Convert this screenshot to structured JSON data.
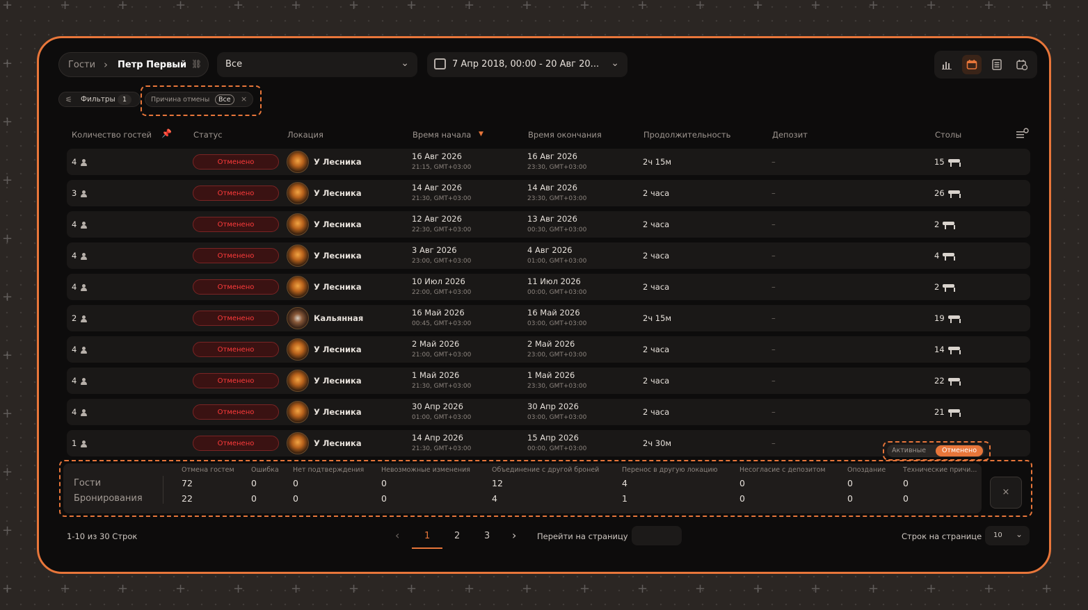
{
  "breadcrumb": {
    "root": "Гости",
    "separator": "›",
    "current": "Петр Первый"
  },
  "filter_select": {
    "value": "Все"
  },
  "date_range": {
    "value": "7 Апр 2018, 00:00 - 20 Авг 20..."
  },
  "view_icons": [
    "chart-icon",
    "calendar-icon",
    "list-icon",
    "calendar-clock-icon"
  ],
  "filters": {
    "label": "Фильтры",
    "count": "1",
    "chip_label": "Причина отмены",
    "chip_value": "Все",
    "chip_close": "×"
  },
  "columns": {
    "guests": "Количество гостей",
    "status": "Статус",
    "location": "Локация",
    "start": "Время начала",
    "end": "Время окончания",
    "duration": "Продолжительность",
    "deposit": "Депозит",
    "tables": "Столы"
  },
  "rows": [
    {
      "guests": "4",
      "status": "Отменено",
      "location": "У Лесника",
      "start_date": "16 Авг 2026",
      "start_time": "21:15, GMT+03:00",
      "end_date": "16 Авг 2026",
      "end_time": "23:30, GMT+03:00",
      "duration": "2ч 15м",
      "deposit": "–",
      "table": "15"
    },
    {
      "guests": "3",
      "status": "Отменено",
      "location": "У Лесника",
      "start_date": "14 Авг 2026",
      "start_time": "21:30, GMT+03:00",
      "end_date": "14 Авг 2026",
      "end_time": "23:30, GMT+03:00",
      "duration": "2 часа",
      "deposit": "–",
      "table": "26"
    },
    {
      "guests": "4",
      "status": "Отменено",
      "location": "У Лесника",
      "start_date": "12 Авг 2026",
      "start_time": "22:30, GMT+03:00",
      "end_date": "13 Авг 2026",
      "end_time": "00:30, GMT+03:00",
      "duration": "2 часа",
      "deposit": "–",
      "table": "2"
    },
    {
      "guests": "4",
      "status": "Отменено",
      "location": "У Лесника",
      "start_date": "3 Авг 2026",
      "start_time": "23:00, GMT+03:00",
      "end_date": "4 Авг 2026",
      "end_time": "01:00, GMT+03:00",
      "duration": "2 часа",
      "deposit": "–",
      "table": "4"
    },
    {
      "guests": "4",
      "status": "Отменено",
      "location": "У Лесника",
      "start_date": "10 Июл 2026",
      "start_time": "22:00, GMT+03:00",
      "end_date": "11 Июл 2026",
      "end_time": "00:00, GMT+03:00",
      "duration": "2 часа",
      "deposit": "–",
      "table": "2"
    },
    {
      "guests": "2",
      "status": "Отменено",
      "location": "Кальянная",
      "start_date": "16 Май 2026",
      "start_time": "00:45, GMT+03:00",
      "end_date": "16 Май 2026",
      "end_time": "03:00, GMT+03:00",
      "duration": "2ч 15м",
      "deposit": "–",
      "table": "19"
    },
    {
      "guests": "4",
      "status": "Отменено",
      "location": "У Лесника",
      "start_date": "2 Май 2026",
      "start_time": "21:00, GMT+03:00",
      "end_date": "2 Май 2026",
      "end_time": "23:00, GMT+03:00",
      "duration": "2 часа",
      "deposit": "–",
      "table": "14"
    },
    {
      "guests": "4",
      "status": "Отменено",
      "location": "У Лесника",
      "start_date": "1 Май 2026",
      "start_time": "21:30, GMT+03:00",
      "end_date": "1 Май 2026",
      "end_time": "23:30, GMT+03:00",
      "duration": "2 часа",
      "deposit": "–",
      "table": "22"
    },
    {
      "guests": "4",
      "status": "Отменено",
      "location": "У Лесника",
      "start_date": "30 Апр 2026",
      "start_time": "01:00, GMT+03:00",
      "end_date": "30 Апр 2026",
      "end_time": "03:00, GMT+03:00",
      "duration": "2 часа",
      "deposit": "–",
      "table": "21"
    },
    {
      "guests": "1",
      "status": "Отменено",
      "location": "У Лесника",
      "start_date": "14 Апр 2026",
      "start_time": "21:30, GMT+03:00",
      "end_date": "15 Апр 2026",
      "end_time": "00:00, GMT+03:00",
      "duration": "2ч 30м",
      "deposit": "–",
      "table": ""
    }
  ],
  "toggle": {
    "active": "Активные",
    "cancelled": "Отменено"
  },
  "summary": {
    "row_labels": [
      "Гости",
      "Бронирования"
    ],
    "headers": [
      "Отмена гостем",
      "Ошибка",
      "Нет подтверждения",
      "Невозможные изменения",
      "Объединение с другой броней",
      "Перенос в другую локацию",
      "Несогласие с депозитом",
      "Опоздание",
      "Технические причи..."
    ],
    "guests": [
      "72",
      "0",
      "0",
      "0",
      "12",
      "4",
      "0",
      "0",
      "0"
    ],
    "bookings": [
      "22",
      "0",
      "0",
      "0",
      "4",
      "1",
      "0",
      "0",
      "0"
    ],
    "close": "×"
  },
  "pagination": {
    "info": "1-10 из 30 Строк",
    "pages": [
      "1",
      "2",
      "3"
    ],
    "prev": "‹",
    "next": "›",
    "goto_label": "Перейти на страницу",
    "rows_label": "Строк на странице",
    "rows_value": "10"
  },
  "colors": {
    "accent": "#e8763a",
    "cancelled": "#ff3b3b"
  }
}
